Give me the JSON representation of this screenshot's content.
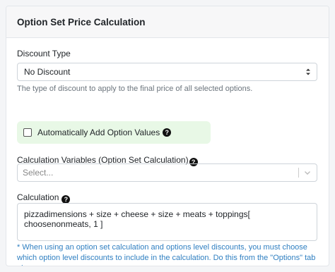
{
  "panel": {
    "title": "Option Set Price Calculation"
  },
  "discount": {
    "label": "Discount Type",
    "selected": "No Discount",
    "help": "The type of discount to apply to the final price of all selected options."
  },
  "auto_add": {
    "label": "Automatically Add Option Values",
    "checked": false
  },
  "calc_vars": {
    "label": "Calculation Variables (Option Set Calculation)",
    "placeholder": "Select..."
  },
  "calculation": {
    "label": "Calculation",
    "value": "pizzadimensions + size + cheese + size + meats + toppings[ choosenonmeats, 1 ]",
    "note": "* When using an option set calculation and options level discounts, you must choose which option level discounts to include in the calculation. Do this from the \"Options\" tab above."
  },
  "help_icon": "?",
  "colors": {
    "accent_green": "#e8f8e6",
    "note_blue": "#2f7fc1"
  }
}
